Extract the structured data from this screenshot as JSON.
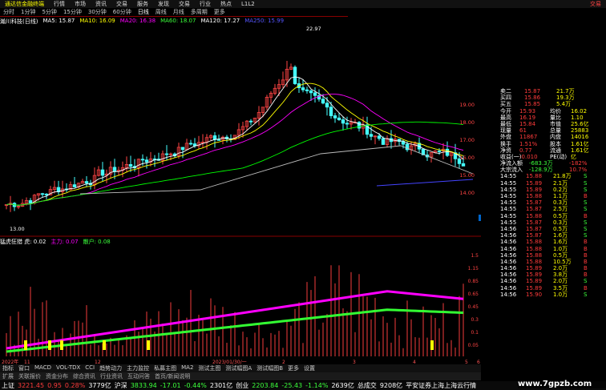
{
  "titlebar": {
    "logo": "通达信金融终端",
    "menus": [
      "行情",
      "市场",
      "资讯",
      "交易",
      "服务",
      "发现",
      "交易",
      "行业",
      "热点",
      "L1L2"
    ],
    "right_label": "交易"
  },
  "period_tabs": [
    "分时",
    "1分钟",
    "5分钟",
    "15分钟",
    "30分钟",
    "60分钟",
    "日线",
    "周线",
    "月线",
    "多周期",
    "更多"
  ],
  "active_period": "日线",
  "ma_legend": {
    "name": "瀚川科技(日线)",
    "ma5": "MA5: 15.87",
    "ma10": "MA10: 16.09",
    "ma20": "MA20: 16.38",
    "ma60": "MA60: 18.07",
    "ma120": "MA120: 17.27",
    "ma250": "MA250: 15.99"
  },
  "price_labels": [
    "19.00",
    "18.00",
    "17.00",
    "16.00",
    "15.00",
    "14.00"
  ],
  "high_label": "22.97",
  "low_label": "13.00",
  "current_price_tag": "13.24",
  "ind_legend": {
    "name": "猛虎狂猎 虎: 0.02",
    "l1": "主力: 0.07",
    "l2": "散户: 0.08"
  },
  "ind_labels": [
    "1.5",
    "1.15",
    "0.85",
    "0.65",
    "0.45",
    "0.3",
    "0.1",
    "0.05"
  ],
  "date_axis": [
    "2022年",
    "11",
    "12",
    "2023/01/30/一",
    "2",
    "3",
    "4",
    "5",
    "6"
  ],
  "tabs": [
    "指标",
    "窗口",
    "MACD",
    "VOL-TDX",
    "CCI",
    "趋势动力",
    "主力监控",
    "私募主图",
    "MA2",
    "测试主图",
    "测试幅图A",
    "测试幅图B",
    "更多",
    "设置"
  ],
  "tabs2": [
    "扩展",
    "关联报价",
    "资金分布",
    "综合资讯",
    "行业资讯",
    "互动问答",
    "首页/新闻说明"
  ],
  "right_panel": {
    "asks": [
      [
        "卖二",
        "15.87",
        "21.7万"
      ],
      [
        "买四",
        "15.86",
        "19.3万"
      ],
      [
        "买五",
        "15.85",
        "5.4万"
      ]
    ],
    "stats": [
      [
        "今开",
        "15.93",
        "均价",
        "16.02"
      ],
      [
        "最高",
        "16.19",
        "量比",
        "1.10"
      ],
      [
        "最低",
        "15.84",
        "市值",
        "25.6亿"
      ],
      [
        "现量",
        "61",
        "总量",
        "25883"
      ],
      [
        "外盘",
        "11867",
        "内盘",
        "14016"
      ],
      [
        "换手",
        "1.51%",
        "股本",
        "1.61亿"
      ],
      [
        "净资",
        "0.77",
        "流通",
        "1.61亿"
      ],
      [
        "收益(一)",
        "-0.010",
        "PE(动)",
        "亿"
      ]
    ],
    "flows": [
      [
        "净流入额",
        "-683.3万",
        "-182%"
      ],
      [
        "大宗流入",
        "-128.9万",
        "10.7%"
      ]
    ],
    "ticks": [
      [
        "14:55",
        "15.88",
        "21.8万",
        "S"
      ],
      [
        "14:55",
        "15.89",
        "2.1万",
        "S"
      ],
      [
        "14:55",
        "15.89",
        "0.2万",
        "S"
      ],
      [
        "14:55",
        "15.88",
        "1.1万",
        "B"
      ],
      [
        "14:55",
        "15.87",
        "0.3万",
        "S"
      ],
      [
        "14:55",
        "15.87",
        "2.5万",
        "S"
      ],
      [
        "14:55",
        "15.88",
        "0.5万",
        "B"
      ],
      [
        "14:55",
        "15.87",
        "0.3万",
        "S"
      ],
      [
        "14:56",
        "15.87",
        "0.5万",
        "S"
      ],
      [
        "14:56",
        "15.87",
        "1.6万",
        "S"
      ],
      [
        "14:56",
        "15.88",
        "1.6万",
        "B"
      ],
      [
        "14:56",
        "15.88",
        "1.0万",
        "B"
      ],
      [
        "14:56",
        "15.88",
        "0.5万",
        "B"
      ],
      [
        "14:56",
        "15.88",
        "10.5万",
        "B"
      ],
      [
        "14:56",
        "15.89",
        "2.0万",
        "B"
      ],
      [
        "14:56",
        "15.89",
        "3.8万",
        "B"
      ],
      [
        "14:56",
        "15.89",
        "2.0万",
        "S"
      ],
      [
        "14:56",
        "15.89",
        "3.5万",
        "B"
      ],
      [
        "14:56",
        "15.90",
        "1.0万",
        "S"
      ]
    ]
  },
  "status": {
    "sh_label": "上证",
    "sh_val": "3221.45",
    "sh_chg": "0.95",
    "sh_pct": "0.28%",
    "sh_amt": "3779亿",
    "sz_label": "沪深",
    "sz_val": "3833.94",
    "sz_chg": "-17.01",
    "sz_pct": "-0.44%",
    "sz_amt": "2301亿",
    "cy_label": "创业",
    "cy_val": "2203.84",
    "cy_chg": "-25.43",
    "cy_pct": "-1.14%",
    "cy_amt": "2639亿",
    "total_label": "总成交",
    "total_amt": "9208亿",
    "broker": "平安证券上海上海云行情"
  },
  "watermark": "www.7gpzb.com"
}
